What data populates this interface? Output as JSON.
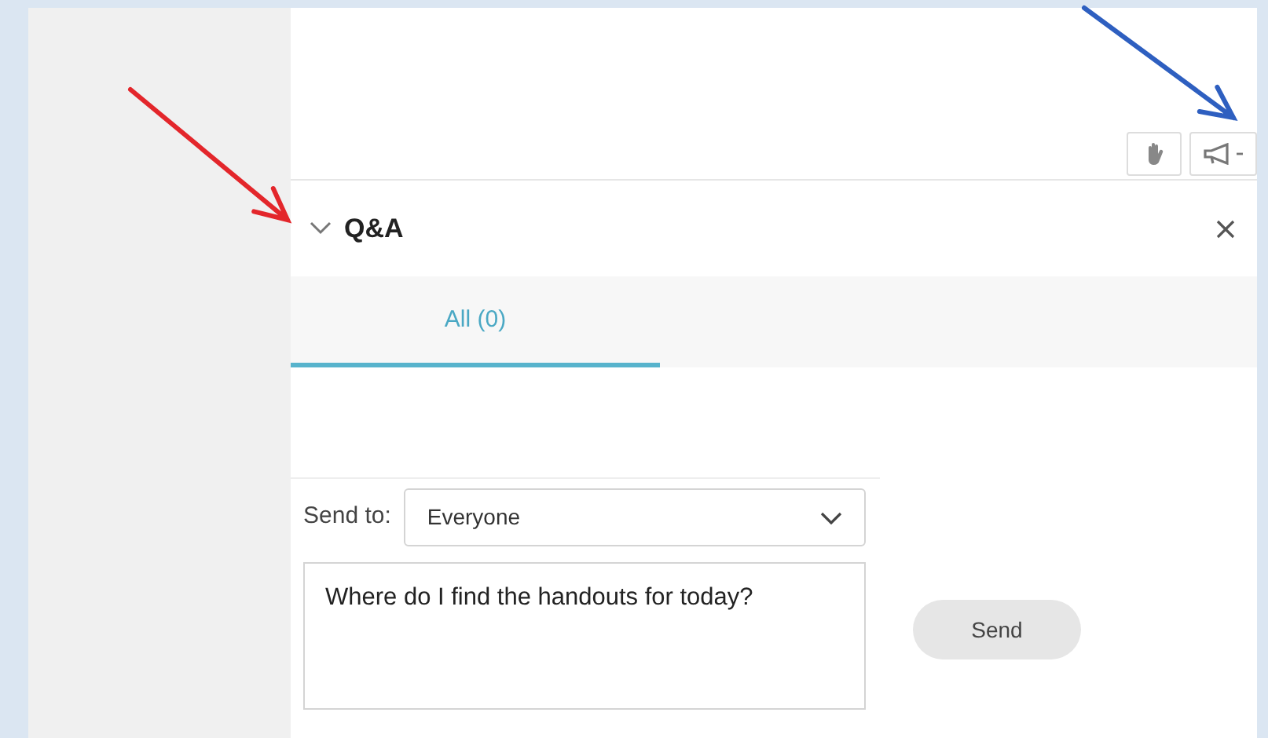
{
  "annotations": [
    {
      "color": "#e3262b"
    },
    {
      "color": "#2e5fc0"
    }
  ],
  "panel": {
    "title": "Q&A",
    "expanded": true
  },
  "tabs": [
    {
      "label": "All (0)",
      "selected": true
    }
  ],
  "compose": {
    "send_to_label": "Send to:",
    "recipient": "Everyone",
    "message": "Where do I find the handouts for today?",
    "send_button": "Send"
  }
}
